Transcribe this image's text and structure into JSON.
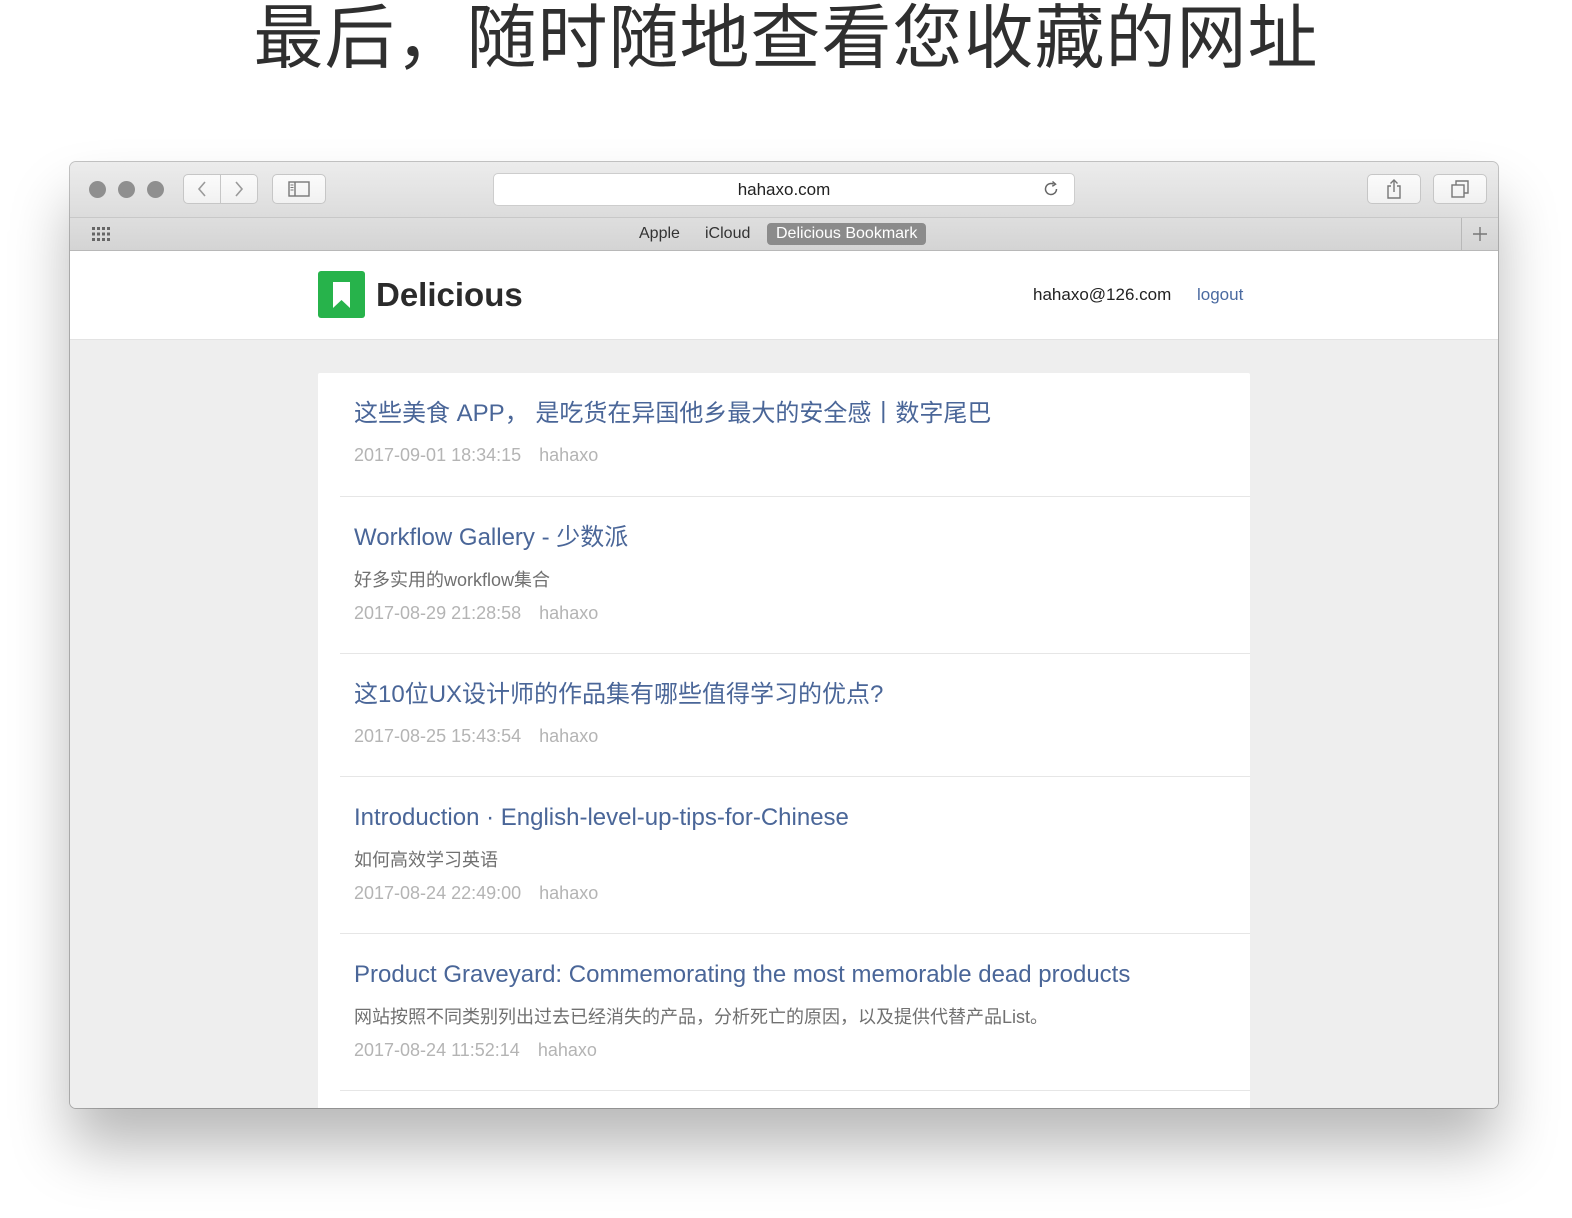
{
  "headline": "最后，随时随地查看您收藏的网址",
  "browser": {
    "url": "hahaxo.com",
    "favorites": [
      "Apple",
      "iCloud",
      "Delicious Bookmark"
    ],
    "active_favorite": "Delicious Bookmark"
  },
  "site": {
    "brand": "Delicious",
    "user_email": "hahaxo@126.com",
    "logout_label": "logout",
    "brand_color": "#27b34b",
    "link_color": "#4a6698"
  },
  "bookmarks": [
    {
      "title": "这些美食 APP， 是吃货在异国他乡最大的安全感丨数字尾巴",
      "description": "",
      "time": "2017-09-01 18:34:15",
      "author": "hahaxo"
    },
    {
      "title": "Workflow Gallery - 少数派",
      "description": "好多实用的workflow集合",
      "time": "2017-08-29 21:28:58",
      "author": "hahaxo"
    },
    {
      "title": "这10位UX设计师的作品集有哪些值得学习的优点?",
      "description": "",
      "time": "2017-08-25 15:43:54",
      "author": "hahaxo"
    },
    {
      "title": "Introduction · English-level-up-tips-for-Chinese",
      "description": "如何高效学习英语",
      "time": "2017-08-24 22:49:00",
      "author": "hahaxo"
    },
    {
      "title": "Product Graveyard: Commemorating the most memorable dead products",
      "description": "网站按照不同类别列出过去已经消失的产品，分析死亡的原因，以及提供代替产品List。",
      "time": "2017-08-24 11:52:14",
      "author": "hahaxo"
    }
  ]
}
